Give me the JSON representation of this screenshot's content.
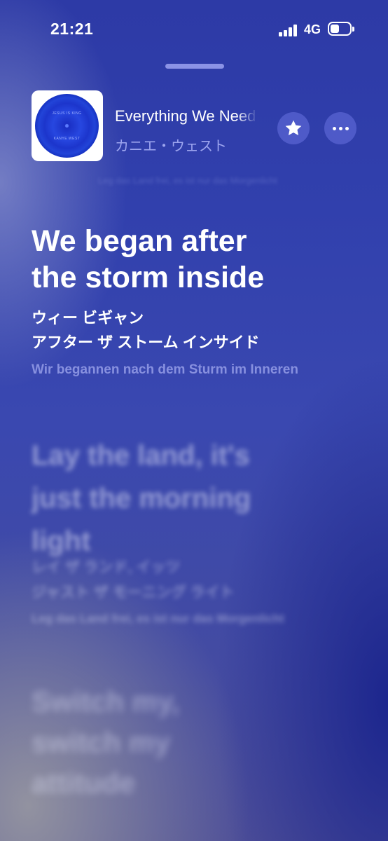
{
  "status": {
    "time": "21:21",
    "network": "4G",
    "battery_level": 0.45
  },
  "now_playing": {
    "title": "Everything We Need",
    "artist": "カニエ・ウェスト",
    "album_art_text": [
      "JESUS IS KING",
      "KANYE WEST"
    ]
  },
  "lyrics": {
    "current": {
      "lines": [
        "We began after",
        "the storm inside"
      ],
      "kana": [
        "ウィー ビギャン",
        "アフター ザ ストーム インサイド"
      ],
      "translation": "Wir begannen nach dem Sturm im Inneren"
    },
    "next": {
      "lines": [
        "Lay the land, it's",
        "just the morning",
        "light"
      ],
      "kana": [
        "レイ ザ ランド, イッツ",
        "ジャスト ザ モーニング ライト"
      ],
      "translation": "Leg das Land frei, es ist nur das Morgenlicht"
    },
    "following": {
      "lines": [
        "Switch my,",
        "switch my",
        "attitude"
      ]
    }
  },
  "icons": {
    "favorite": "star-icon",
    "more": "ellipsis-icon"
  }
}
